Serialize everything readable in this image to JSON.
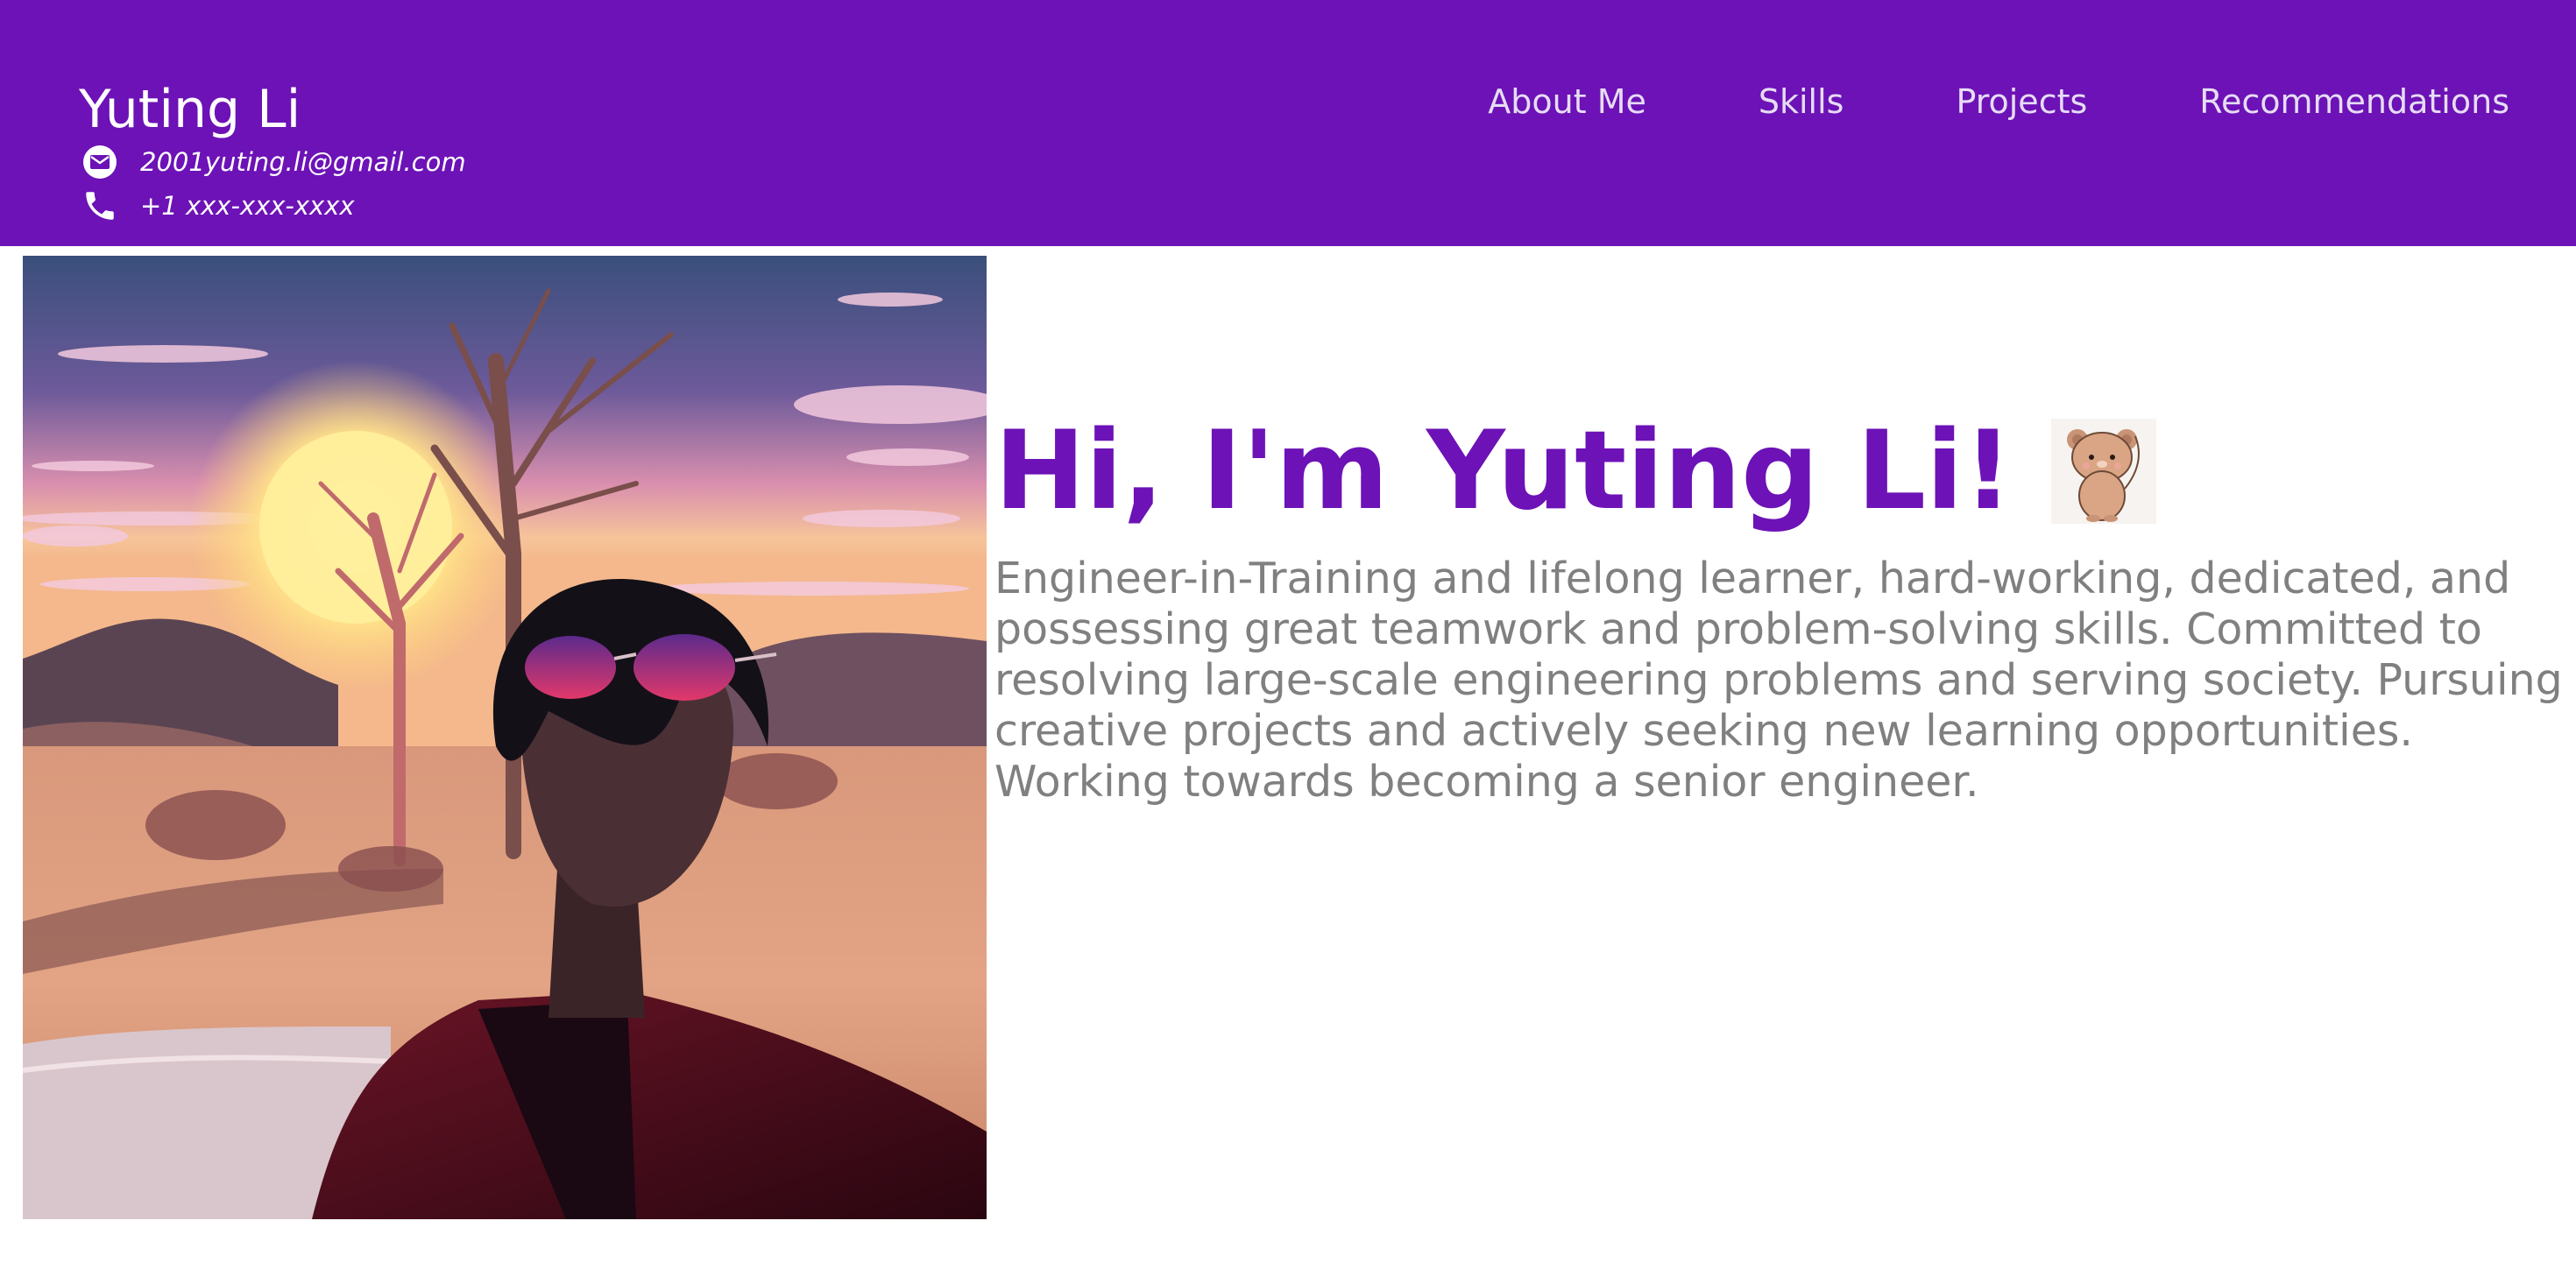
{
  "header": {
    "name": "Yuting Li",
    "email": "2001yuting.li@gmail.com",
    "phone": "+1 xxx-xxx-xxxx",
    "email_icon": "envelope-icon",
    "phone_icon": "phone-icon",
    "background_color": "#6c12b6"
  },
  "nav": {
    "items": [
      {
        "label": "About Me"
      },
      {
        "label": "Skills"
      },
      {
        "label": "Projects"
      },
      {
        "label": "Recommendations"
      }
    ],
    "text_color": "#e6dcf4"
  },
  "hero": {
    "photo": "portrait-photo",
    "heading": "Hi, I'm Yuting Li!",
    "heading_color": "#6c12b6",
    "sticker": "bear-sticker",
    "bio": "Engineer-in-Training and lifelong learner, hard-working, dedicated, and possessing great teamwork and problem-solving skills. Committed to resolving large-scale engineering problems and serving society. Pursuing creative projects and actively seeking new learning opportunities. Working towards becoming a senior engineer.",
    "bio_color": "#808080"
  }
}
